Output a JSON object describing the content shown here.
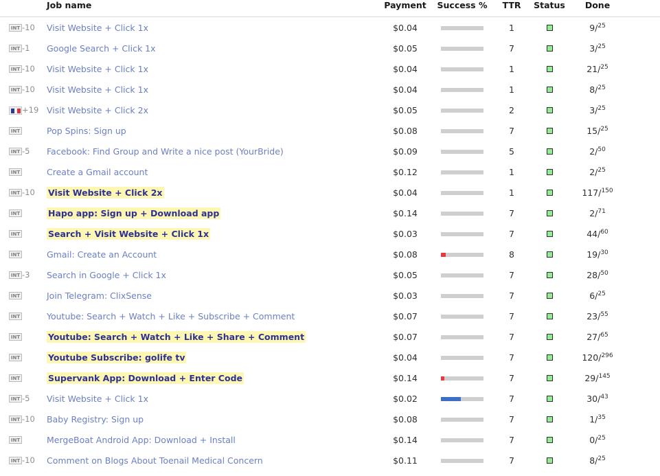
{
  "table": {
    "columns": {
      "flag": "",
      "rating": "",
      "name": "Job name",
      "payment": "Payment",
      "success": "Success %",
      "ttr": "TTR",
      "status": "Status",
      "done": "Done"
    },
    "badge_label": "INT",
    "rows": [
      {
        "badge": "INT",
        "flag": false,
        "rating": "-10",
        "name": "Visit Website + Click 1x",
        "highlight": false,
        "payment": "$0.04",
        "success_neg_pct": 0,
        "success_pos_pct": 0,
        "ttr": "1",
        "status": "active",
        "done_num": "9",
        "done_den": "25"
      },
      {
        "badge": "INT",
        "flag": false,
        "rating": "-1",
        "name": "Google Search + Click 1x",
        "highlight": false,
        "payment": "$0.05",
        "success_neg_pct": 0,
        "success_pos_pct": 0,
        "ttr": "7",
        "status": "active",
        "done_num": "3",
        "done_den": "25"
      },
      {
        "badge": "INT",
        "flag": false,
        "rating": "-10",
        "name": "Visit Website + Click 1x",
        "highlight": false,
        "payment": "$0.04",
        "success_neg_pct": 0,
        "success_pos_pct": 0,
        "ttr": "1",
        "status": "active",
        "done_num": "21",
        "done_den": "25"
      },
      {
        "badge": "INT",
        "flag": false,
        "rating": "-10",
        "name": "Visit Website + Click 1x",
        "highlight": false,
        "payment": "$0.04",
        "success_neg_pct": 0,
        "success_pos_pct": 0,
        "ttr": "1",
        "status": "active",
        "done_num": "8",
        "done_den": "25"
      },
      {
        "badge": "",
        "flag": true,
        "rating": "+19",
        "name": "Visit Website + Click 2x",
        "highlight": false,
        "payment": "$0.05",
        "success_neg_pct": 0,
        "success_pos_pct": 0,
        "ttr": "2",
        "status": "active",
        "done_num": "3",
        "done_den": "25"
      },
      {
        "badge": "INT",
        "flag": false,
        "rating": "",
        "name": "Pop Spins: Sign up",
        "highlight": false,
        "payment": "$0.08",
        "success_neg_pct": 0,
        "success_pos_pct": 0,
        "ttr": "7",
        "status": "active",
        "done_num": "15",
        "done_den": "25"
      },
      {
        "badge": "INT",
        "flag": false,
        "rating": "-5",
        "name": "Facebook: Find Group and Write a nice post (YourBride)",
        "highlight": false,
        "payment": "$0.09",
        "success_neg_pct": 0,
        "success_pos_pct": 0,
        "ttr": "5",
        "status": "active",
        "done_num": "2",
        "done_den": "50"
      },
      {
        "badge": "INT",
        "flag": false,
        "rating": "",
        "name": "Create a Gmail account",
        "highlight": false,
        "payment": "$0.12",
        "success_neg_pct": 0,
        "success_pos_pct": 0,
        "ttr": "1",
        "status": "active",
        "done_num": "2",
        "done_den": "25"
      },
      {
        "badge": "INT",
        "flag": false,
        "rating": "-10",
        "name": "Visit Website + Click 2x",
        "highlight": true,
        "payment": "$0.04",
        "success_neg_pct": 0,
        "success_pos_pct": 0,
        "ttr": "1",
        "status": "active",
        "done_num": "117",
        "done_den": "150"
      },
      {
        "badge": "INT",
        "flag": false,
        "rating": "",
        "name": "Hapo app: Sign up + Download app",
        "highlight": true,
        "payment": "$0.14",
        "success_neg_pct": 0,
        "success_pos_pct": 0,
        "ttr": "7",
        "status": "active",
        "done_num": "2",
        "done_den": "71"
      },
      {
        "badge": "INT",
        "flag": false,
        "rating": "",
        "name": "Search + Visit Website + Click 1x",
        "highlight": true,
        "payment": "$0.03",
        "success_neg_pct": 0,
        "success_pos_pct": 0,
        "ttr": "7",
        "status": "active",
        "done_num": "44",
        "done_den": "60"
      },
      {
        "badge": "INT",
        "flag": false,
        "rating": "",
        "name": "Gmail: Create an Account",
        "highlight": false,
        "payment": "$0.08",
        "success_neg_pct": 12,
        "success_pos_pct": 0,
        "ttr": "8",
        "status": "active",
        "done_num": "19",
        "done_den": "30"
      },
      {
        "badge": "INT",
        "flag": false,
        "rating": "-3",
        "name": "Search in Google + Click 1x",
        "highlight": false,
        "payment": "$0.05",
        "success_neg_pct": 0,
        "success_pos_pct": 0,
        "ttr": "7",
        "status": "active",
        "done_num": "28",
        "done_den": "50"
      },
      {
        "badge": "INT",
        "flag": false,
        "rating": "",
        "name": "Join Telegram: ClixSense",
        "highlight": false,
        "payment": "$0.03",
        "success_neg_pct": 0,
        "success_pos_pct": 0,
        "ttr": "7",
        "status": "active",
        "done_num": "6",
        "done_den": "25"
      },
      {
        "badge": "INT",
        "flag": false,
        "rating": "",
        "name": "Youtube: Search + Watch + Like + Subscribe + Comment",
        "highlight": false,
        "payment": "$0.07",
        "success_neg_pct": 0,
        "success_pos_pct": 0,
        "ttr": "7",
        "status": "active",
        "done_num": "23",
        "done_den": "55"
      },
      {
        "badge": "INT",
        "flag": false,
        "rating": "",
        "name": "Youtube: Search + Watch + Like + Share + Comment",
        "highlight": true,
        "payment": "$0.07",
        "success_neg_pct": 0,
        "success_pos_pct": 0,
        "ttr": "7",
        "status": "active",
        "done_num": "27",
        "done_den": "65"
      },
      {
        "badge": "INT",
        "flag": false,
        "rating": "",
        "name": "Youtube Subscribe: golife tv",
        "highlight": true,
        "payment": "$0.04",
        "success_neg_pct": 0,
        "success_pos_pct": 0,
        "ttr": "7",
        "status": "active",
        "done_num": "120",
        "done_den": "296"
      },
      {
        "badge": "INT",
        "flag": false,
        "rating": "",
        "name": "Supervank App: Download + Enter Code",
        "highlight": true,
        "payment": "$0.14",
        "success_neg_pct": 8,
        "success_pos_pct": 0,
        "ttr": "7",
        "status": "active",
        "done_num": "29",
        "done_den": "145"
      },
      {
        "badge": "INT",
        "flag": false,
        "rating": "-5",
        "name": "Visit Website + Click 1x",
        "highlight": false,
        "payment": "$0.02",
        "success_neg_pct": 0,
        "success_pos_pct": 47,
        "ttr": "7",
        "status": "active",
        "done_num": "30",
        "done_den": "43"
      },
      {
        "badge": "INT",
        "flag": false,
        "rating": "-10",
        "name": "Baby Registry: Sign up",
        "highlight": false,
        "payment": "$0.08",
        "success_neg_pct": 0,
        "success_pos_pct": 0,
        "ttr": "7",
        "status": "active",
        "done_num": "1",
        "done_den": "35"
      },
      {
        "badge": "INT",
        "flag": false,
        "rating": "",
        "name": "MergeBoat Android App: Download + Install",
        "highlight": false,
        "payment": "$0.14",
        "success_neg_pct": 0,
        "success_pos_pct": 0,
        "ttr": "7",
        "status": "active",
        "done_num": "0",
        "done_den": "25"
      },
      {
        "badge": "INT",
        "flag": false,
        "rating": "-10",
        "name": "Comment on Blogs About Toenail Medical Concern",
        "highlight": false,
        "payment": "$0.11",
        "success_neg_pct": 0,
        "success_pos_pct": 0,
        "ttr": "7",
        "status": "active",
        "done_num": "8",
        "done_den": "25"
      }
    ]
  },
  "colors": {
    "link": "#6b7fc4",
    "highlight_bg": "#fdf7b3",
    "highlight_text": "#2e3192",
    "bar_base": "#cfcfcf",
    "bar_negative": "#e8393f",
    "bar_positive": "#3f6fc4",
    "status_active": "#93ec93"
  }
}
